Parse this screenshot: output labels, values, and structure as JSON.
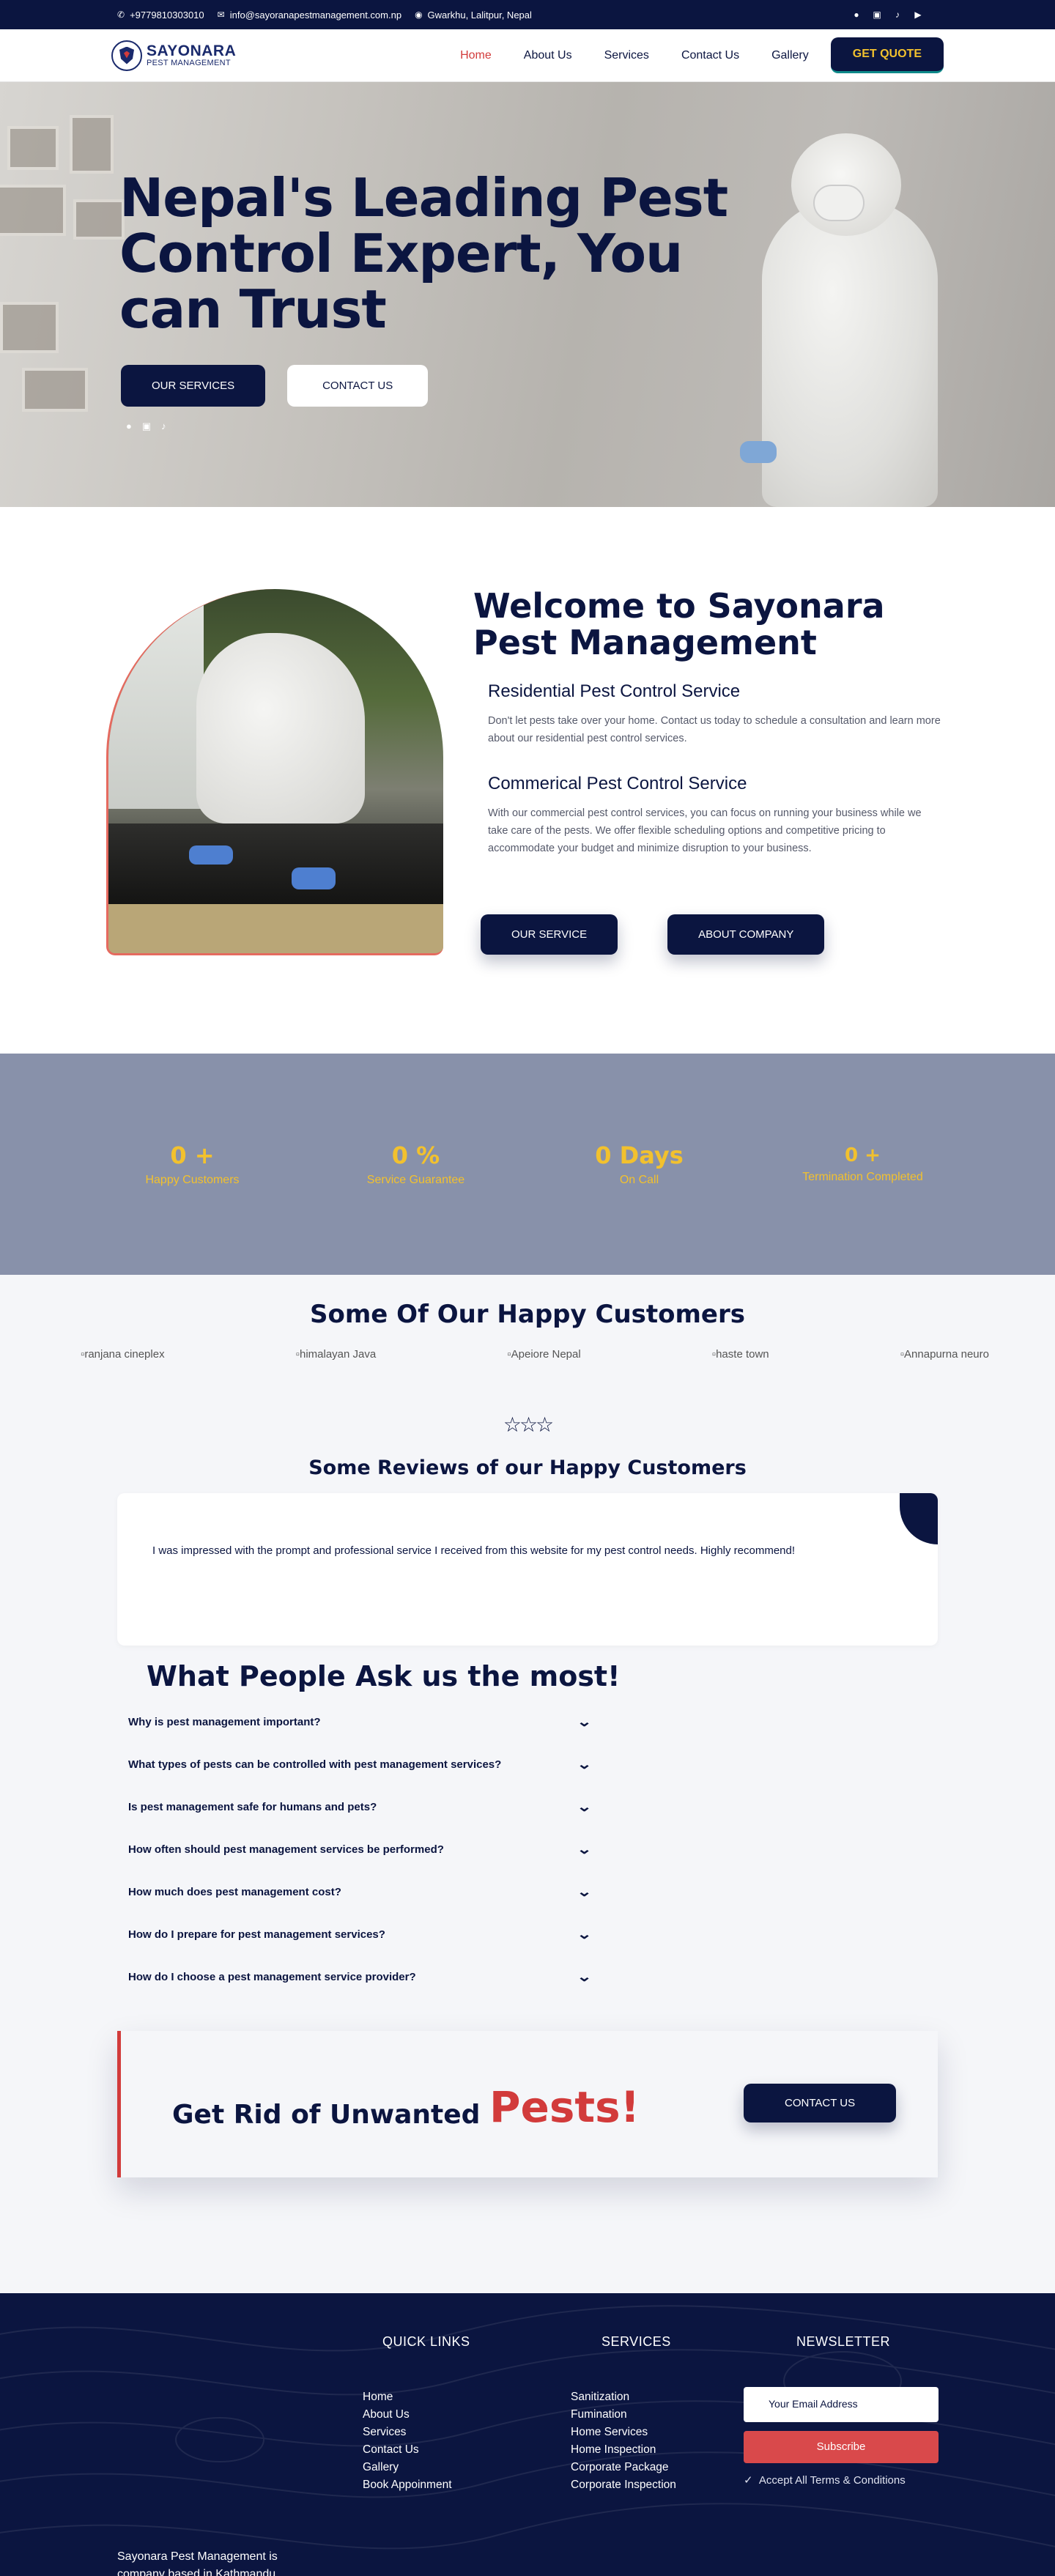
{
  "topbar": {
    "phone": "+9779810303010",
    "email": "info@sayoranapestmanagement.com.np",
    "address": "Gwarkhu, Lalitpur, Nepal",
    "social_icons": [
      "facebook-icon",
      "instagram-icon",
      "tiktok-icon",
      "youtube-icon"
    ]
  },
  "brand": {
    "name": "SAYONARA",
    "tagline": "PEST MANAGEMENT"
  },
  "nav": {
    "items": [
      "Home",
      "About Us",
      "Services",
      "Contact Us",
      "Gallery"
    ],
    "active": "Home",
    "cta": "GET QUOTE"
  },
  "hero": {
    "title": "Nepal's Leading Pest Control Expert, You can Trust",
    "primary_button": "OUR SERVICES",
    "secondary_button": "CONTACT US"
  },
  "welcome": {
    "title": "Welcome to Sayonara Pest Management",
    "services": [
      {
        "title": "Residential Pest Control Service",
        "text": "Don't let pests take over your home. Contact us today to schedule a consultation and learn more about our residential pest control services."
      },
      {
        "title": "Commerical Pest Control Service",
        "text": "With our commercial pest control services, you can focus on running your business while we take care of the pests. We offer flexible scheduling options and competitive pricing to accommodate your budget and minimize disruption to your business."
      }
    ],
    "button_service": "OUR SERVICE",
    "button_about": "ABOUT COMPANY"
  },
  "stats": [
    {
      "value": "0 +",
      "label": "Happy Customers"
    },
    {
      "value": "0 %",
      "label": "Service Guarantee"
    },
    {
      "value": "0 Days",
      "label": "On Call"
    },
    {
      "value": "0 +",
      "label": "Termination Completed"
    }
  ],
  "customers": {
    "title": "Some Of Our Happy Customers",
    "logos": [
      "ranjana cineplex",
      "himalayan Java",
      "Apeiore Nepal",
      "haste town",
      "Annapurna neuro"
    ]
  },
  "reviews": {
    "stars": "☆☆☆",
    "title": "Some Reviews of our Happy Customers",
    "text": "I was impressed with the prompt and professional service I received from this website for my pest control needs. Highly recommend!"
  },
  "faq": {
    "title": "What People Ask us the most!",
    "questions": [
      "Why is pest management important?",
      "What types of pests can be controlled with pest management services?",
      "Is pest management safe for humans and pets?",
      "How often should pest management services be performed?",
      "How much does pest management cost?",
      "How do I prepare for pest management services?",
      "How do I choose a pest management service provider?"
    ]
  },
  "cta": {
    "text": "Get Rid of Unwanted",
    "highlight": "Pests!",
    "button": "CONTACT US"
  },
  "footer": {
    "quick_links_title": "QUICK LINKS",
    "quick_links": [
      "Home",
      "About Us",
      "Services",
      "Contact Us",
      "Gallery",
      "Book Appoinment"
    ],
    "services_title": "SERVICES",
    "services": [
      "Sanitization",
      "Fumination",
      "Home Services",
      "Home Inspection",
      "Corporate Package",
      "Corporate Inspection"
    ],
    "newsletter_title": "NEWSLETTER",
    "email_placeholder": "Your Email Address",
    "subscribe": "Subscribe",
    "terms": "Accept All Terms & Conditions",
    "about": "Sayonara Pest Management is company based in Kathmandu"
  },
  "colors": {
    "navy": "#0b1540",
    "accent_red": "#d23b3b",
    "gold": "#f2c12e",
    "stats_bg": "#8891aa"
  }
}
